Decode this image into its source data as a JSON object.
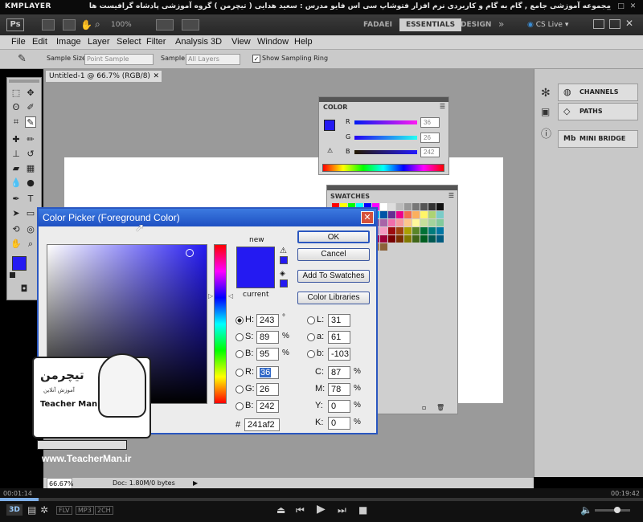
{
  "player": {
    "logo": "KMPLAYER",
    "caption": "مجموعه آموزشی جامع , گام به گام و کاربردی نرم افزار فتوشاپ سی اس فایو مدرس : سعید هدایی ( تیچرمن ) گروه آموزشی پادشاه گرافیست ها",
    "time_elapsed": "00:01:14",
    "time_total": "00:19:42",
    "progress": 0.06,
    "badges": [
      "FLV",
      "MP3",
      "2CH"
    ],
    "colors": {
      "bar": "#0b0b0b",
      "progress": "#7fb0e8"
    }
  },
  "appbar": {
    "logo": "Ps",
    "zoom": "100%",
    "workspaces": [
      "FADAEI",
      "ESSENTIALS",
      "DESIGN"
    ],
    "active_workspace": "ESSENTIALS",
    "more": "»",
    "cslive": "CS Live"
  },
  "menus": [
    "File",
    "Edit",
    "Image",
    "Layer",
    "Select",
    "Filter",
    "Analysis",
    "3D",
    "View",
    "Window",
    "Help"
  ],
  "options": {
    "sample_size_label": "Sample Size:",
    "sample_size_value": "Point Sample",
    "sample_label": "Sample:",
    "sample_value": "All Layers",
    "show_ring_label": "Show Sampling Ring",
    "show_ring_checked": true
  },
  "document": {
    "tab": "Untitled-1 @ 66.7% (RGB/8)",
    "zoom": "66.67%",
    "doc_size": "Doc: 1.80M/0 bytes"
  },
  "panels": {
    "channels": "CHANNELS",
    "paths": "PATHS",
    "mini_bridge": "MINI BRIDGE",
    "color": {
      "title": "COLOR",
      "r_label": "R",
      "g_label": "G",
      "b_label": "B",
      "r": "36",
      "g": "26",
      "b": "242"
    },
    "swatches": {
      "title": "SWATCHES"
    }
  },
  "picker": {
    "title": "Color Picker (Foreground Color)",
    "new_label": "new",
    "current_label": "current",
    "ok": "OK",
    "cancel": "Cancel",
    "add_swatches": "Add To Swatches",
    "libraries": "Color Libraries",
    "fields": {
      "H": "243",
      "S": "89",
      "B": "95",
      "R": "36",
      "G": "26",
      "Bv": "242",
      "L": "31",
      "a": "61",
      "b": "-103",
      "C": "87",
      "M": "78",
      "Y": "0",
      "K": "0"
    },
    "labels": {
      "H": "H:",
      "S": "S:",
      "B": "B:",
      "R": "R:",
      "G": "G:",
      "Bv": "B:",
      "L": "L:",
      "a": "a:",
      "b": "b:",
      "C": "C:",
      "M": "M:",
      "Y": "Y:",
      "K": "K:",
      "deg": "°",
      "pct": "%",
      "hash": "#"
    },
    "hex": "241af2",
    "color_new": "#241af2",
    "color_current": "#241af2"
  },
  "watermark": {
    "logo_text": "تیچرمن",
    "sub_text": "آموزش آنلاین",
    "name": "Teacher Man",
    "url": "www.TeacherMan.ir"
  }
}
